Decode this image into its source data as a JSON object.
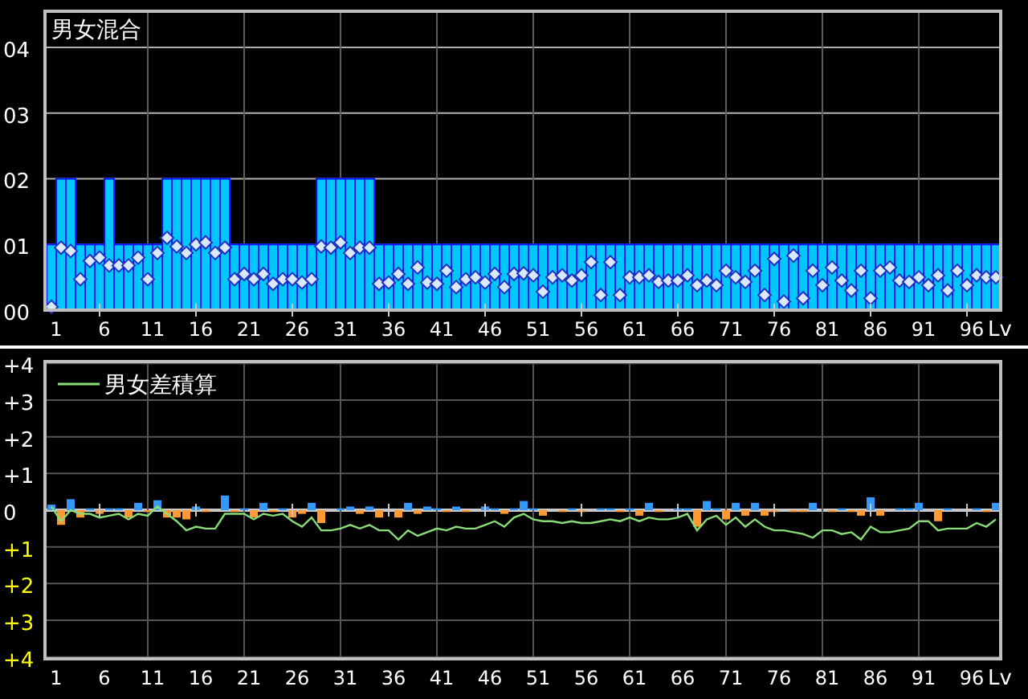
{
  "charts": [
    {
      "chart_data": {
        "type": "bar",
        "title": "男女混合",
        "xlabel": "Lv",
        "grid": true,
        "xlim": [
          1,
          99
        ],
        "ylim": [
          0,
          4.55
        ],
        "x": [
          1,
          2,
          3,
          4,
          5,
          6,
          7,
          8,
          9,
          10,
          11,
          12,
          13,
          14,
          15,
          16,
          17,
          18,
          19,
          20,
          21,
          22,
          23,
          24,
          25,
          26,
          27,
          28,
          29,
          30,
          31,
          32,
          33,
          34,
          35,
          36,
          37,
          38,
          39,
          40,
          41,
          42,
          43,
          44,
          45,
          46,
          47,
          48,
          49,
          50,
          51,
          52,
          53,
          54,
          55,
          56,
          57,
          58,
          59,
          60,
          61,
          62,
          63,
          64,
          65,
          66,
          67,
          68,
          69,
          70,
          71,
          72,
          73,
          74,
          75,
          76,
          77,
          78,
          79,
          80,
          81,
          82,
          83,
          84,
          85,
          86,
          87,
          88,
          89,
          90,
          91,
          92,
          93,
          94,
          95,
          96,
          97,
          98,
          99
        ],
        "xticks": [
          1,
          6,
          11,
          16,
          21,
          26,
          31,
          36,
          41,
          46,
          51,
          56,
          61,
          66,
          71,
          76,
          81,
          86,
          91,
          96
        ],
        "yticks": [
          {
            "value": 0,
            "label": "00"
          },
          {
            "value": 1,
            "label": "01"
          },
          {
            "value": 2,
            "label": "02"
          },
          {
            "value": 3,
            "label": "03"
          },
          {
            "value": 4,
            "label": "04"
          }
        ],
        "series": [
          {
            "type": "bar",
            "color": "#00c8ff",
            "values": [
              1,
              2,
              2,
              1,
              1,
              1,
              2,
              1,
              1,
              1,
              1,
              1,
              2,
              2,
              2,
              2,
              2,
              2,
              2,
              1,
              1,
              1,
              1,
              1,
              1,
              1,
              1,
              1,
              2,
              2,
              2,
              2,
              2,
              2,
              1,
              1,
              1,
              1,
              1,
              1,
              1,
              1,
              1,
              1,
              1,
              1,
              1,
              1,
              1,
              1,
              1,
              1,
              1,
              1,
              1,
              1,
              1,
              1,
              1,
              1,
              1,
              1,
              1,
              1,
              1,
              1,
              1,
              1,
              1,
              1,
              1,
              1,
              1,
              1,
              1,
              1,
              1,
              1,
              1,
              1,
              1,
              1,
              1,
              1,
              1,
              1,
              1,
              1,
              1,
              1,
              1,
              1,
              1,
              1,
              1,
              1,
              1,
              1,
              1
            ]
          },
          {
            "type": "scatter",
            "color": "#d8e8ff",
            "values": [
              0.05,
              0.95,
              0.9,
              0.47,
              0.75,
              0.8,
              0.68,
              0.68,
              0.68,
              0.8,
              0.47,
              0.87,
              1.1,
              0.97,
              0.87,
              1.0,
              1.03,
              0.87,
              0.95,
              0.47,
              0.55,
              0.47,
              0.55,
              0.4,
              0.47,
              0.47,
              0.42,
              0.47,
              0.97,
              0.95,
              1.03,
              0.87,
              0.95,
              0.95,
              0.4,
              0.42,
              0.55,
              0.4,
              0.65,
              0.42,
              0.4,
              0.6,
              0.35,
              0.47,
              0.5,
              0.42,
              0.55,
              0.35,
              0.55,
              0.56,
              0.53,
              0.28,
              0.5,
              0.53,
              0.45,
              0.53,
              0.73,
              0.23,
              0.73,
              0.23,
              0.5,
              0.5,
              0.53,
              0.43,
              0.45,
              0.45,
              0.53,
              0.38,
              0.45,
              0.38,
              0.6,
              0.5,
              0.43,
              0.6,
              0.23,
              0.78,
              0.13,
              0.83,
              0.18,
              0.6,
              0.38,
              0.65,
              0.45,
              0.3,
              0.6,
              0.18,
              0.6,
              0.65,
              0.45,
              0.43,
              0.5,
              0.38,
              0.53,
              0.3,
              0.6,
              0.38,
              0.53,
              0.5,
              0.5
            ]
          }
        ]
      }
    },
    {
      "chart_data": {
        "type": "bar",
        "xlabel": "Lv",
        "grid": true,
        "xlim": [
          1,
          99
        ],
        "ylim": [
          -4.05,
          4.05
        ],
        "x": [
          1,
          2,
          3,
          4,
          5,
          6,
          7,
          8,
          9,
          10,
          11,
          12,
          13,
          14,
          15,
          16,
          17,
          18,
          19,
          20,
          21,
          22,
          23,
          24,
          25,
          26,
          27,
          28,
          29,
          30,
          31,
          32,
          33,
          34,
          35,
          36,
          37,
          38,
          39,
          40,
          41,
          42,
          43,
          44,
          45,
          46,
          47,
          48,
          49,
          50,
          51,
          52,
          53,
          54,
          55,
          56,
          57,
          58,
          59,
          60,
          61,
          62,
          63,
          64,
          65,
          66,
          67,
          68,
          69,
          70,
          71,
          72,
          73,
          74,
          75,
          76,
          77,
          78,
          79,
          80,
          81,
          82,
          83,
          84,
          85,
          86,
          87,
          88,
          89,
          90,
          91,
          92,
          93,
          94,
          95,
          96,
          97,
          98,
          99
        ],
        "xticks": [
          1,
          6,
          11,
          16,
          21,
          26,
          31,
          36,
          41,
          46,
          51,
          56,
          61,
          66,
          71,
          76,
          81,
          86,
          91,
          96
        ],
        "yticks": [
          {
            "value": 4,
            "label": "+4"
          },
          {
            "value": 3,
            "label": "+3"
          },
          {
            "value": 2,
            "label": "+2"
          },
          {
            "value": 1,
            "label": "+1"
          },
          {
            "value": 0,
            "label": "0"
          },
          {
            "value": -1,
            "label": "+1"
          },
          {
            "value": -2,
            "label": "+2"
          },
          {
            "value": -3,
            "label": "+3"
          },
          {
            "value": -4,
            "label": "+4"
          }
        ],
        "series": [
          {
            "type": "bar",
            "color": "#3399ff",
            "values": [
              0.15,
              null,
              0.3,
              null,
              0.05,
              null,
              0.05,
              0.05,
              null,
              0.2,
              null,
              0.27,
              null,
              null,
              null,
              0.1,
              null,
              null,
              0.4,
              null,
              0.05,
              null,
              0.2,
              null,
              0.05,
              null,
              null,
              0.2,
              null,
              null,
              0.05,
              0.1,
              null,
              0.1,
              null,
              null,
              null,
              0.2,
              null,
              0.1,
              0.05,
              null,
              0.1,
              null,
              null,
              0.1,
              0.05,
              null,
              0.05,
              0.25,
              0.05,
              null,
              null,
              null,
              0.05,
              null,
              null,
              0.05,
              0.05,
              null,
              0.05,
              null,
              0.2,
              null,
              null,
              0.05,
              0.05,
              null,
              0.25,
              0.05,
              null,
              0.2,
              null,
              0.2,
              null,
              null,
              null,
              null,
              null,
              0.2,
              null,
              null,
              0.05,
              null,
              null,
              0.35,
              null,
              null,
              0.05,
              0.05,
              0.2,
              null,
              null,
              0.05,
              null,
              null,
              0.05,
              null,
              0.2
            ]
          },
          {
            "type": "bar",
            "color": "#ff9933",
            "values": [
              null,
              -0.4,
              null,
              -0.2,
              null,
              -0.1,
              null,
              null,
              -0.2,
              null,
              -0.05,
              null,
              -0.2,
              -0.2,
              -0.25,
              null,
              -0.05,
              null,
              null,
              -0.05,
              null,
              -0.2,
              null,
              -0.05,
              null,
              -0.2,
              -0.1,
              null,
              -0.35,
              null,
              null,
              null,
              -0.1,
              null,
              -0.2,
              null,
              -0.2,
              null,
              -0.1,
              null,
              null,
              -0.05,
              null,
              -0.05,
              null,
              null,
              null,
              -0.1,
              null,
              null,
              null,
              -0.15,
              null,
              -0.05,
              null,
              -0.05,
              null,
              null,
              null,
              -0.05,
              null,
              -0.15,
              null,
              -0.05,
              null,
              null,
              null,
              -0.45,
              null,
              null,
              -0.25,
              null,
              -0.15,
              null,
              -0.15,
              -0.05,
              null,
              -0.05,
              -0.05,
              null,
              null,
              -0.05,
              null,
              -0.05,
              -0.15,
              null,
              -0.15,
              null,
              null,
              null,
              null,
              null,
              -0.3,
              null,
              null,
              null,
              null,
              -0.05,
              null
            ]
          },
          {
            "type": "line",
            "name": "男女差積算",
            "color": "#88dd77",
            "values": [
              0.1,
              -0.3,
              0,
              -0.1,
              -0.1,
              -0.2,
              -0.15,
              -0.1,
              -0.25,
              -0.1,
              -0.15,
              0.1,
              -0.1,
              -0.3,
              -0.55,
              -0.45,
              -0.5,
              -0.5,
              -0.1,
              -0.1,
              -0.1,
              -0.25,
              -0.1,
              -0.15,
              -0.1,
              -0.3,
              -0.45,
              -0.2,
              -0.55,
              -0.55,
              -0.5,
              -0.4,
              -0.5,
              -0.4,
              -0.55,
              -0.55,
              -0.8,
              -0.55,
              -0.7,
              -0.6,
              -0.5,
              -0.55,
              -0.45,
              -0.5,
              -0.5,
              -0.4,
              -0.3,
              -0.45,
              -0.2,
              -0.1,
              -0.25,
              -0.3,
              -0.3,
              -0.35,
              -0.3,
              -0.35,
              -0.35,
              -0.3,
              -0.25,
              -0.3,
              -0.2,
              -0.3,
              -0.2,
              -0.25,
              -0.25,
              -0.2,
              -0.1,
              -0.55,
              -0.25,
              -0.15,
              -0.4,
              -0.2,
              -0.45,
              -0.25,
              -0.45,
              -0.55,
              -0.55,
              -0.6,
              -0.65,
              -0.75,
              -0.55,
              -0.55,
              -0.65,
              -0.6,
              -0.8,
              -0.45,
              -0.6,
              -0.6,
              -0.55,
              -0.5,
              -0.3,
              -0.3,
              -0.55,
              -0.5,
              -0.5,
              -0.5,
              -0.35,
              -0.45,
              -0.25
            ]
          }
        ]
      }
    }
  ]
}
